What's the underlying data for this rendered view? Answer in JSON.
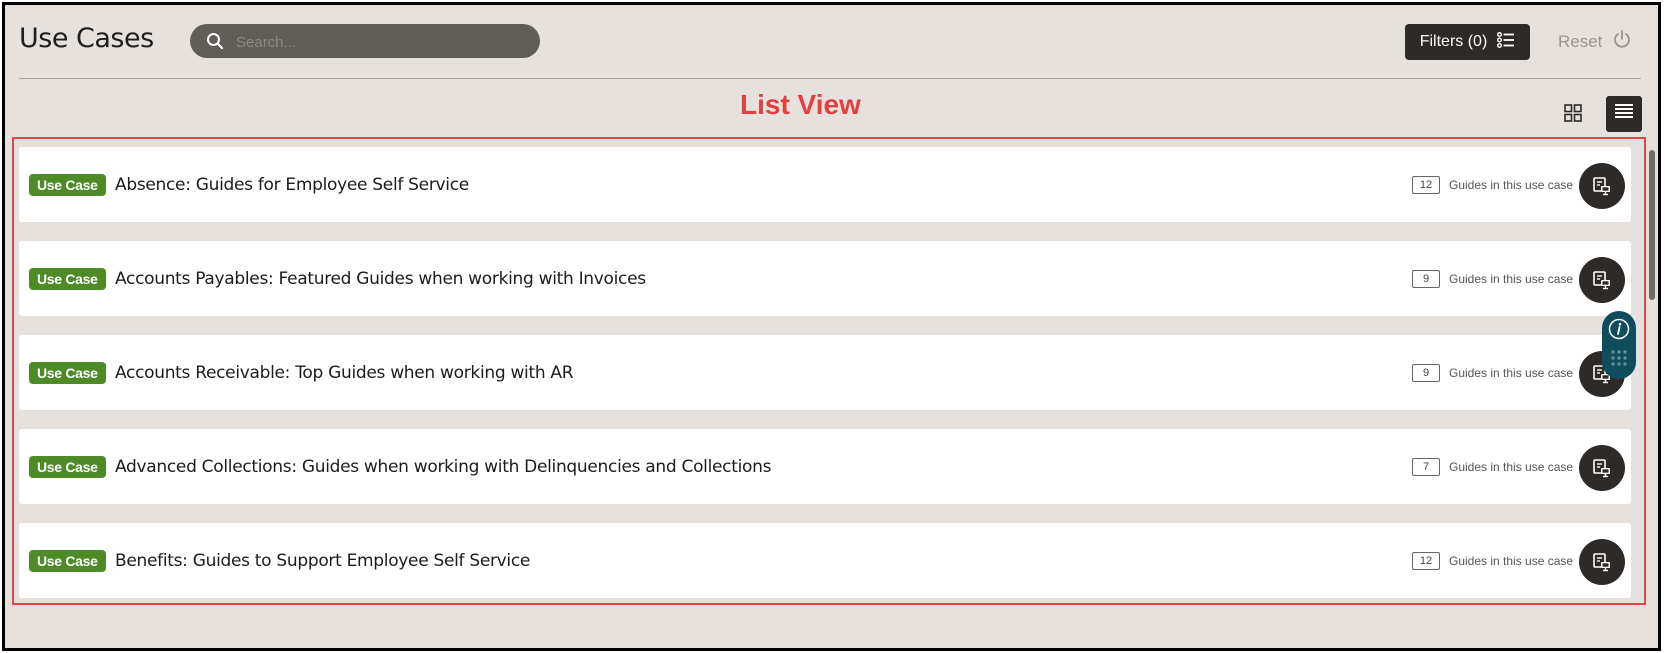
{
  "header": {
    "title": "Use Cases",
    "search_placeholder": "Search...",
    "filters_label": "Filters (0)",
    "reset_label": "Reset"
  },
  "annotation": {
    "label": "List View"
  },
  "view_toggle": {
    "selected": "list",
    "options": [
      "grid",
      "list"
    ]
  },
  "colors": {
    "badge": "#4e8a28",
    "annotation": "#e04040",
    "dark_button": "#2d2a27",
    "help_widget": "#0f4c5c"
  },
  "cards": [
    {
      "badge": "Use Case",
      "title": "Absence: Guides for Employee Self Service",
      "count": "12",
      "count_label": "Guides in this use case",
      "icon": "guide-icon"
    },
    {
      "badge": "Use Case",
      "title": "Accounts Payables: Featured Guides when working with Invoices",
      "count": "9",
      "count_label": "Guides in this use case",
      "icon": "guide-icon"
    },
    {
      "badge": "Use Case",
      "title": "Accounts Receivable: Top Guides when working with AR",
      "count": "9",
      "count_label": "Guides in this use case",
      "icon": "guide-icon"
    },
    {
      "badge": "Use Case",
      "title": "Advanced Collections: Guides when working with Delinquencies and Collections",
      "count": "7",
      "count_label": "Guides in this use case",
      "icon": "guide-icon"
    },
    {
      "badge": "Use Case",
      "title": "Benefits: Guides to Support Employee Self Service",
      "count": "12",
      "count_label": "Guides in this use case",
      "icon": "guide-icon"
    }
  ]
}
